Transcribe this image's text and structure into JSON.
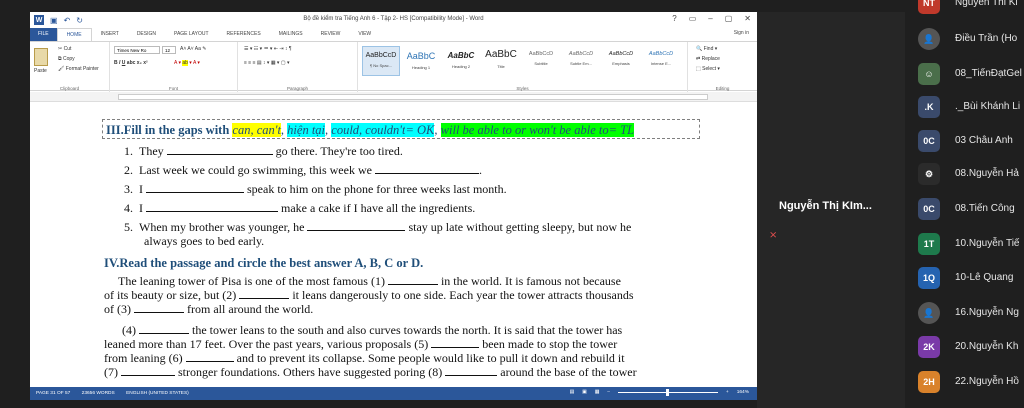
{
  "word": {
    "title": "Bộ đề kiểm tra Tiếng Anh 6 - Tập 2- HS [Compatibility Mode] - Word",
    "tabs": [
      "FILE",
      "HOME",
      "INSERT",
      "DESIGN",
      "PAGE LAYOUT",
      "REFERENCES",
      "MAILINGS",
      "REVIEW",
      "VIEW"
    ],
    "sign_in": "Sign in",
    "window_controls": [
      "?",
      "▭",
      "–",
      "▢",
      "✕"
    ],
    "clipboard": {
      "paste": "Paste",
      "cut": "Cut",
      "copy": "Copy",
      "format_painter": "Format Painter",
      "label": "Clipboard"
    },
    "font": {
      "name": "Times New Ro",
      "size": "12",
      "label": "Font"
    },
    "paragraph_label": "Paragraph",
    "styles": [
      {
        "sample": "AaBbCcD",
        "name": "¶ No Spac..."
      },
      {
        "sample": "AaBbC",
        "name": "Heading 1"
      },
      {
        "sample": "AaBbC",
        "name": "Heading 2"
      },
      {
        "sample": "AaBbC",
        "name": "Title"
      },
      {
        "sample": "AaBbCcD",
        "name": "Subtitle"
      },
      {
        "sample": "AaBbCcD",
        "name": "Subtle Em..."
      },
      {
        "sample": "AaBbCcD",
        "name": "Emphasis"
      },
      {
        "sample": "AaBbCcD",
        "name": "Intense E..."
      }
    ],
    "styles_label": "Styles",
    "editing": {
      "find": "Find",
      "replace": "Replace",
      "select": "Select",
      "label": "Editing"
    }
  },
  "doc": {
    "section3": {
      "prefix": "III.Fill in the gaps with ",
      "w1": "can, can't",
      "w2": "hiện tại",
      "w3": "could, couldn't",
      "w4": "OK",
      "w5": "will be able to or won't be able to",
      "w6": "TL"
    },
    "items": [
      {
        "num": "1.",
        "a": "They",
        "b": "go there. They're too tired."
      },
      {
        "num": "2.",
        "a": "Last week we could go swimming, this week we",
        "b": "."
      },
      {
        "num": "3.",
        "a": "I",
        "b": "speak to him on the phone for three weeks last month."
      },
      {
        "num": "4.",
        "a": "I",
        "b": "make a cake if I have all the ingredients."
      },
      {
        "num": "5.",
        "a": "When my brother was younger, he",
        "b": "stay up late without getting sleepy, but now he",
        "c": "always goes to bed early."
      }
    ],
    "section4": "IV.Read the passage and circle the best answer A, B, C or D.",
    "passage": [
      {
        "a": "The leaning tower of Pisa is one of the most famous (1)",
        "b": "in the world. It is famous not because"
      },
      {
        "a": "of its beauty or size, but (2)",
        "b": "it leans dangerously to one side. Each year the tower attracts thousands"
      },
      {
        "a": "of (3)",
        "b": "from all around the world."
      },
      {
        "a": "(4)",
        "b": "the tower leans to the south and also curves towards the north. It is said that the tower has"
      },
      {
        "a": "leaned more than 17 feet. Over the past years, various proposals (5)",
        "b": "been made to stop the tower"
      },
      {
        "a": "from leaning (6)",
        "b": "and to prevent its collapse. Some people would like to pull it down and rebuild it"
      },
      {
        "a": "(7)",
        "b": "stronger foundations. Others have suggested poring (8)",
        "c": "around the base of the tower"
      }
    ]
  },
  "status": {
    "page": "PAGE 31 OF 57",
    "words": "23656 WORDS",
    "language": "ENGLISH (UNITED STATES)",
    "zoom": "164%"
  },
  "meeting": {
    "speaker": "Nguyễn Thị KIm...",
    "participants": [
      {
        "initials": "NT",
        "name": "Nguyen Thi Ki",
        "color": "#c0392b"
      },
      {
        "initials": "",
        "name": "Điều Trần (Ho",
        "color": "#2b2b2b"
      },
      {
        "initials": "",
        "name": "08_TiếnĐạtGel",
        "color": "#2b2b2b"
      },
      {
        "initials": ".K",
        "name": "._Bùi Khánh Li",
        "color": "#3a4a6b"
      },
      {
        "initials": "0C",
        "name": "03 Châu Anh",
        "color": "#3a4a6b"
      },
      {
        "initials": "",
        "name": "08.Nguyễn Hả",
        "color": "#2b2b2b"
      },
      {
        "initials": "0C",
        "name": "08.Tiến Công",
        "color": "#3a4a6b"
      },
      {
        "initials": "1T",
        "name": "10.Nguyễn Tiế",
        "color": "#1e7a4c"
      },
      {
        "initials": "1Q",
        "name": "10-Lê Quang",
        "color": "#2563b0"
      },
      {
        "initials": "",
        "name": "16.Nguyễn Ng",
        "color": "#2b2b2b"
      },
      {
        "initials": "2K",
        "name": "20.Nguyễn Kh",
        "color": "#7a3aa8"
      },
      {
        "initials": "2H",
        "name": "22.Nguyễn Hồ",
        "color": "#d9822b"
      }
    ]
  }
}
